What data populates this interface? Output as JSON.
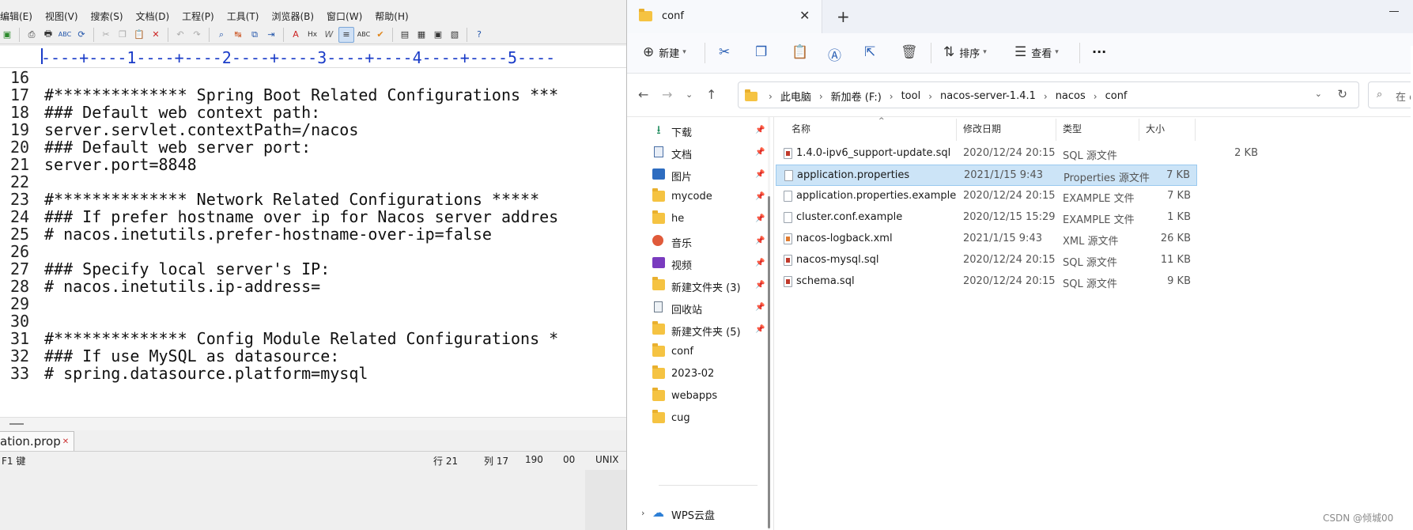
{
  "editor": {
    "menu": [
      "编辑(E)",
      "视图(V)",
      "搜索(S)",
      "文档(D)",
      "工程(P)",
      "工具(T)",
      "浏览器(B)",
      "窗口(W)",
      "帮助(H)"
    ],
    "ruler": "----+----1----+----2----+----3----+----4----+----5----",
    "lines": [
      {
        "num": "16",
        "code": ""
      },
      {
        "num": "17",
        "code": "#************** Spring Boot Related Configurations ***"
      },
      {
        "num": "18",
        "code": "### Default web context path:"
      },
      {
        "num": "19",
        "code": "server.servlet.contextPath=/nacos"
      },
      {
        "num": "20",
        "code": "### Default web server port:"
      },
      {
        "num": "21",
        "code": "server.port=8848"
      },
      {
        "num": "22",
        "code": ""
      },
      {
        "num": "23",
        "code": "#************** Network Related Configurations *****"
      },
      {
        "num": "24",
        "code": "### If prefer hostname over ip for Nacos server addres"
      },
      {
        "num": "25",
        "code": "# nacos.inetutils.prefer-hostname-over-ip=false"
      },
      {
        "num": "26",
        "code": ""
      },
      {
        "num": "27",
        "code": "### Specify local server's IP:"
      },
      {
        "num": "28",
        "code": "# nacos.inetutils.ip-address="
      },
      {
        "num": "29",
        "code": ""
      },
      {
        "num": "30",
        "code": ""
      },
      {
        "num": "31",
        "code": "#************** Config Module Related Configurations *"
      },
      {
        "num": "32",
        "code": "### If use MySQL as datasource:"
      },
      {
        "num": "33",
        "code": "# spring.datasource.platform=mysql"
      }
    ],
    "tab_label": "ation.prop",
    "statusbar": {
      "hint": "F1 键",
      "row": "行 21",
      "col": "列 17",
      "chars": "190",
      "code": "00",
      "eol": "UNIX"
    }
  },
  "explorer": {
    "tab_title": "conf",
    "commands": {
      "new": "新建",
      "sort": "排序",
      "view": "查看",
      "more": "···"
    },
    "breadcrumb": [
      "此电脑",
      "新加卷 (F:)",
      "tool",
      "nacos-server-1.4.1",
      "nacos",
      "conf"
    ],
    "search_placeholder": "在 co",
    "nav_items": [
      {
        "label": "下载",
        "icon": "download-icon",
        "pinned": true
      },
      {
        "label": "文档",
        "icon": "documents-icon",
        "pinned": true
      },
      {
        "label": "图片",
        "icon": "pictures-icon",
        "pinned": true
      },
      {
        "label": "mycode",
        "icon": "folder-icon",
        "pinned": true
      },
      {
        "label": "he",
        "icon": "folder-icon",
        "pinned": true
      },
      {
        "label": "音乐",
        "icon": "music-icon",
        "pinned": true
      },
      {
        "label": "视频",
        "icon": "videos-icon",
        "pinned": true
      },
      {
        "label": "新建文件夹 (3)",
        "icon": "folder-icon",
        "pinned": true
      },
      {
        "label": "回收站",
        "icon": "recycle-bin-icon",
        "pinned": true
      },
      {
        "label": "新建文件夹 (5)",
        "icon": "folder-icon",
        "pinned": true
      },
      {
        "label": "conf",
        "icon": "folder-icon",
        "pinned": false
      },
      {
        "label": "2023-02",
        "icon": "folder-icon",
        "pinned": false
      },
      {
        "label": "webapps",
        "icon": "folder-icon",
        "pinned": false
      },
      {
        "label": "cug",
        "icon": "folder-icon",
        "pinned": false
      }
    ],
    "wps_cloud": "WPS云盘",
    "columns": {
      "name": "名称",
      "date": "修改日期",
      "type": "类型",
      "size": "大小"
    },
    "files": [
      {
        "name": "1.4.0-ipv6_support-update.sql",
        "date": "2020/12/24 20:15",
        "type": "SQL 源文件",
        "size": "2 KB",
        "kind": "sql",
        "selected": false
      },
      {
        "name": "application.properties",
        "date": "2021/1/15 9:43",
        "type": "Properties 源文件",
        "size": "7 KB",
        "kind": "text",
        "selected": true
      },
      {
        "name": "application.properties.example",
        "date": "2020/12/24 20:15",
        "type": "EXAMPLE 文件",
        "size": "7 KB",
        "kind": "text",
        "selected": false
      },
      {
        "name": "cluster.conf.example",
        "date": "2020/12/15 15:29",
        "type": "EXAMPLE 文件",
        "size": "1 KB",
        "kind": "text",
        "selected": false
      },
      {
        "name": "nacos-logback.xml",
        "date": "2021/1/15 9:43",
        "type": "XML 源文件",
        "size": "26 KB",
        "kind": "xml",
        "selected": false
      },
      {
        "name": "nacos-mysql.sql",
        "date": "2020/12/24 20:15",
        "type": "SQL 源文件",
        "size": "11 KB",
        "kind": "sql",
        "selected": false
      },
      {
        "name": "schema.sql",
        "date": "2020/12/24 20:15",
        "type": "SQL 源文件",
        "size": "9 KB",
        "kind": "sql",
        "selected": false
      }
    ],
    "watermark": "CSDN @倾城00"
  }
}
